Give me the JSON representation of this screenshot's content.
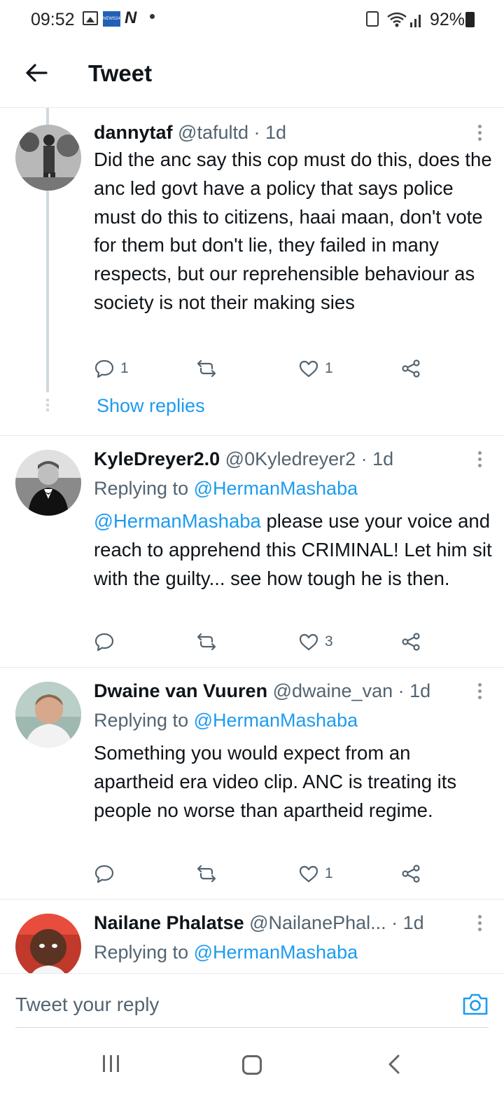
{
  "status_bar": {
    "time": "09:52",
    "left_icons": [
      "gallery-icon",
      "news-icon",
      "n-app-icon",
      "dot-icon"
    ],
    "news_label": "NEWS24",
    "n_label": "N",
    "right_text": "92%",
    "right_icons": [
      "lock-icon",
      "wifi-icon",
      "signal-icon",
      "battery-icon"
    ]
  },
  "header": {
    "back_icon": "arrow-left-icon",
    "title": "Tweet"
  },
  "tweets": [
    {
      "name": "dannytaf",
      "handle": "@tafultd",
      "time": "· 1d",
      "replying_label": "",
      "replying_to": "",
      "body_mention": "",
      "body": "Did the anc say this cop must do this, does the anc led govt have a policy that says police must do this to citizens, haai maan, don't vote for them but don't lie, they failed in many respects, but our reprehensible behaviour as society is not their making sies",
      "reply_count": "1",
      "retweet_count": "",
      "like_count": "1",
      "show_replies": "Show replies"
    },
    {
      "name": "KyleDreyer2.0",
      "handle": "@0Kyledreyer2",
      "time": "· 1d",
      "replying_label": "Replying to ",
      "replying_to": "@HermanMashaba",
      "body_mention": "@HermanMashaba",
      "body": " please use your voice and reach to apprehend this CRIMINAL! Let him sit with the guilty... see how tough he is then.",
      "reply_count": "",
      "retweet_count": "",
      "like_count": "3"
    },
    {
      "name": "Dwaine van Vuuren",
      "handle": "@dwaine_van",
      "time": "· 1d",
      "replying_label": "Replying to ",
      "replying_to": "@HermanMashaba",
      "body_mention": "",
      "body": "Something you would expect from an apartheid era video clip. ANC is treating its people no worse than apartheid regime.",
      "reply_count": "",
      "retweet_count": "",
      "like_count": "1"
    },
    {
      "name": "Nailane Phalatse",
      "handle": "@NailanePhal...",
      "time": "· 1d",
      "replying_label": "Replying to ",
      "replying_to": "@HermanMashaba"
    }
  ],
  "reply_box": {
    "placeholder": "Tweet your reply",
    "camera_icon": "camera-icon"
  },
  "nav_bar": {
    "icons": [
      "recent-apps-icon",
      "home-icon",
      "back-icon"
    ]
  },
  "colors": {
    "accent": "#1d9bf0",
    "text": "#0f1419",
    "muted": "#536471",
    "divider": "#e6ecf0"
  }
}
